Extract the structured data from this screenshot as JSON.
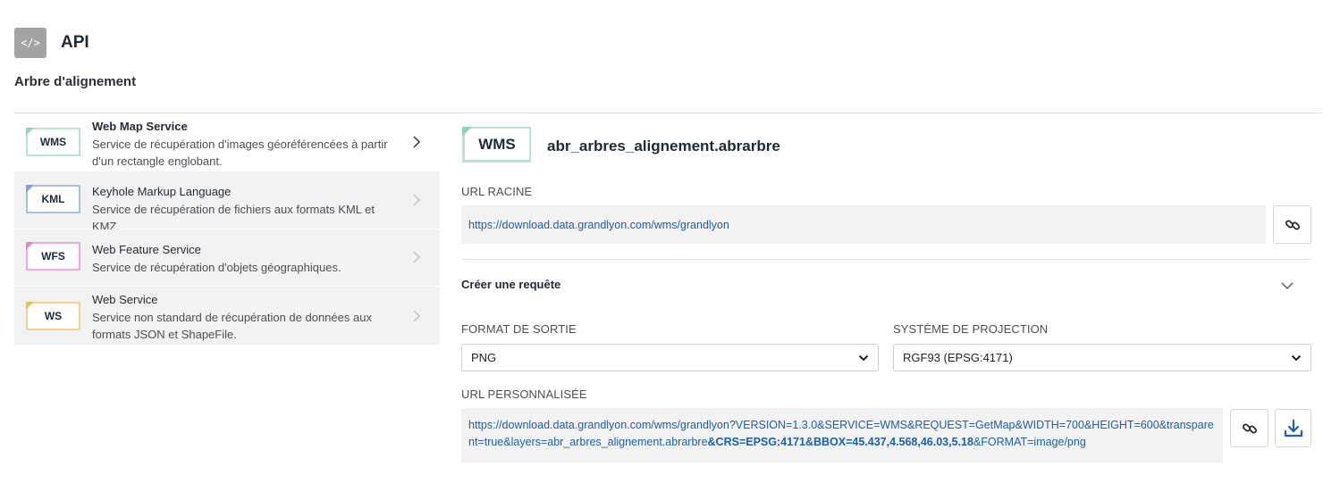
{
  "header": {
    "api_icon_text": "</>",
    "title": "API",
    "subtitle": "Arbre d'alignement"
  },
  "services": [
    {
      "badge": "WMS",
      "name": "Web Map Service",
      "desc": "Service de récupération d'images géoréférencées à partir d'un rectangle englobant.",
      "active": true,
      "color": "#8fd7b2"
    },
    {
      "badge": "KML",
      "name": "Keyhole Markup Language",
      "desc": "Service de récupération de fichiers aux formats KML et KMZ.",
      "active": false,
      "color": "#7e9fe0"
    },
    {
      "badge": "WFS",
      "name": "Web Feature Service",
      "desc": "Service de récupération d'objets géographiques.",
      "active": false,
      "color": "#ec86c6"
    },
    {
      "badge": "WS",
      "name": "Web Service",
      "desc": "Service non standard de récupération de données aux formats JSON et ShapeFile.",
      "active": false,
      "color": "#f0bb5a"
    }
  ],
  "detail": {
    "badge": "WMS",
    "layer_name": "abr_arbres_alignement.abrarbre",
    "root_url_label": "URL RACINE",
    "root_url": "https://download.data.grandlyon.com/wms/grandlyon",
    "request_title": "Créer une requête",
    "output_format_label": "FORMAT DE SORTIE",
    "output_format_value": "PNG",
    "projection_label": "SYSTÈME DE PROJECTION",
    "projection_value": "RGF93 (EPSG:4171)",
    "custom_url_label": "URL PERSONNALISÉE",
    "custom_url_part1": "https://download.data.grandlyon.com/wms/grandlyon?VERSION=1.3.0&SERVICE=WMS&REQUEST=GetMap&WIDTH=700&HEIGHT=600&transparent=true&layers=abr_arbres_alignement.abrarbre",
    "custom_url_part2": "&CRS=EPSG:4171&BBOX=45.437,4.568,46.03,5.18",
    "custom_url_part3": "&FORMAT=image/png"
  },
  "icons": {
    "copy_link": "link-icon",
    "download": "download-icon",
    "chevron_right": "chevron-right-icon",
    "chevron_down": "chevron-down-icon"
  },
  "colors": {
    "link": "#1e5fa8",
    "panel_bg": "#f2f2f2",
    "download_icon": "#1e5fa8"
  }
}
